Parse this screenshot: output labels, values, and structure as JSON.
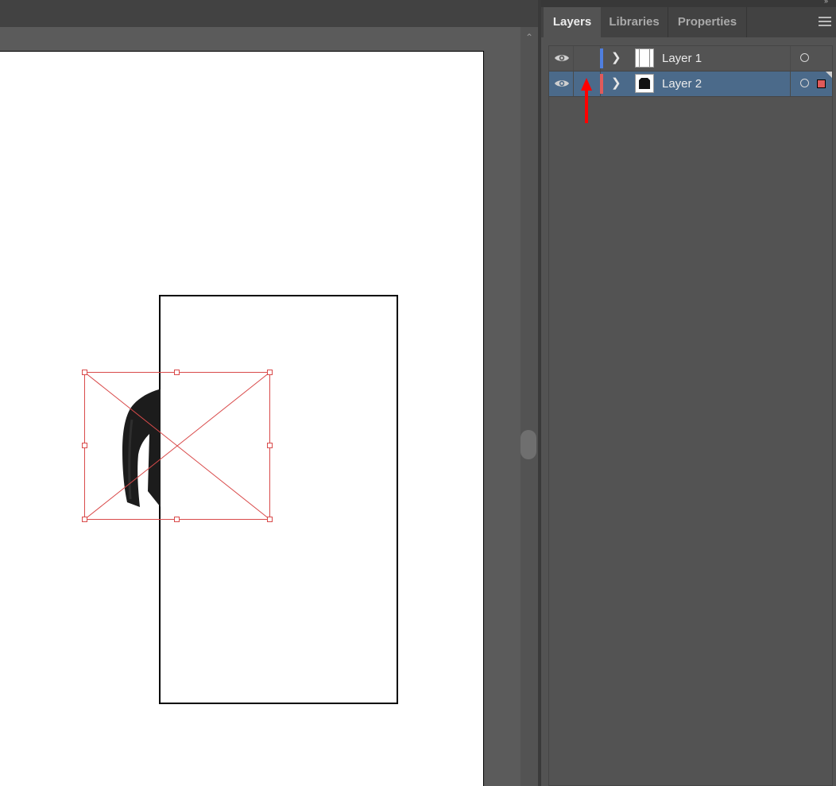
{
  "panel": {
    "tabs": [
      {
        "label": "Layers",
        "active": true
      },
      {
        "label": "Libraries",
        "active": false
      },
      {
        "label": "Properties",
        "active": false
      }
    ],
    "menu_icon": "hamburger-menu-icon"
  },
  "layers": [
    {
      "name": "Layer 1",
      "visible": true,
      "color": "#4f7fe0",
      "selected": false,
      "thumbnail": "blank-page-thumbnail"
    },
    {
      "name": "Layer 2",
      "visible": true,
      "color": "#e05a5a",
      "selected": true,
      "thumbnail": "jacket-thumbnail"
    }
  ],
  "colors": {
    "selection": "#d94a4a",
    "panel_bg": "#535353",
    "selected_row": "#4b6a8a",
    "annotation_arrow": "#ff0000"
  },
  "canvas": {
    "placed_image": "black-jacket-photo",
    "annotation": "red-arrow-pointing-up-at-lock-column"
  }
}
